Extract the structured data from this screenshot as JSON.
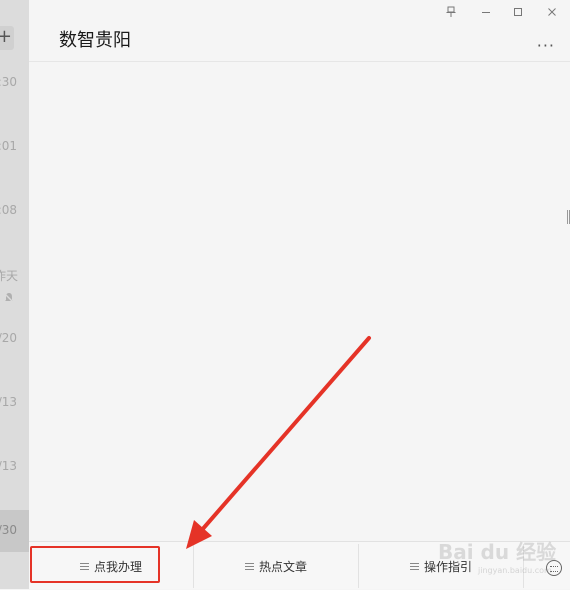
{
  "window": {
    "title": "数智贵阳",
    "controls": {
      "pin": "pin-icon",
      "minimize": "minimize-icon",
      "maximize": "maximize-icon",
      "close": "close-icon"
    },
    "more": "···"
  },
  "sidebar": {
    "add": "+",
    "times": [
      ":30",
      ":01",
      ":08",
      "昨天",
      "/20",
      "/13",
      "/13",
      "/30"
    ]
  },
  "menu": {
    "items": [
      {
        "label": "点我办理"
      },
      {
        "label": "热点文章"
      },
      {
        "label": "操作指引"
      }
    ]
  },
  "annotation": {
    "color": "#e53327"
  },
  "watermark": {
    "brand": "Bai du 经验",
    "url": "jingyan.baidu.com"
  }
}
